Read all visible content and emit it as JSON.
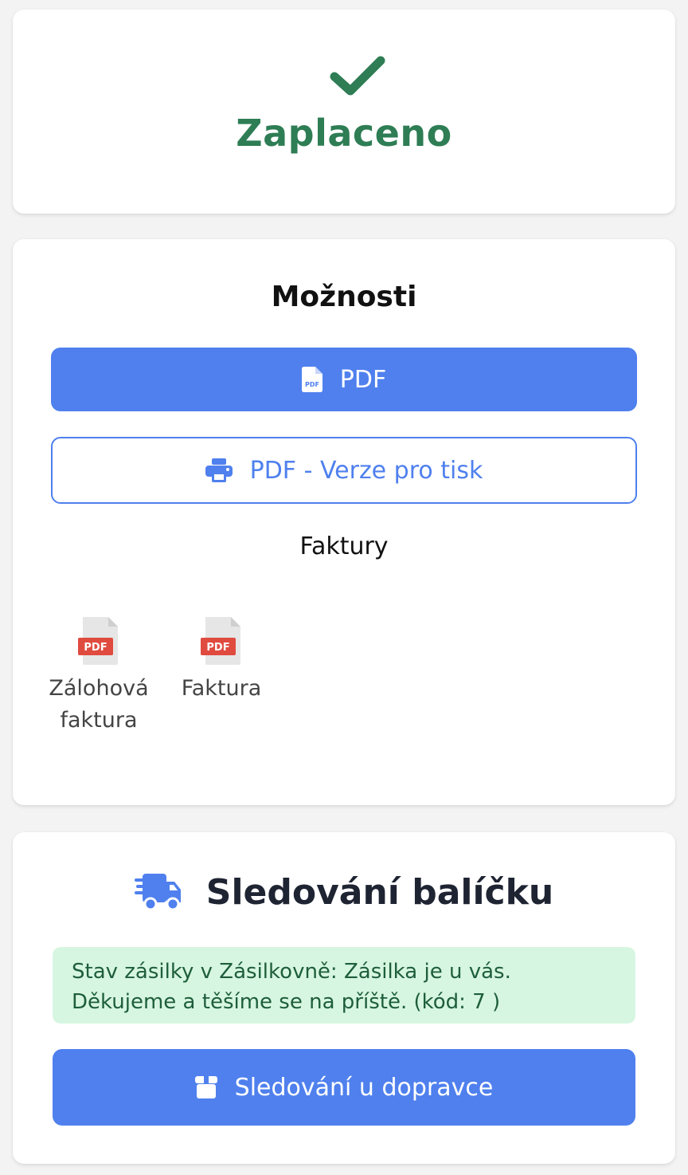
{
  "status": {
    "label": "Zaplaceno",
    "color": "#2e7d55",
    "icon": "check-icon"
  },
  "options": {
    "title": "Možnosti",
    "pdf_button": {
      "label": "PDF",
      "icon": "file-pdf-icon"
    },
    "print_button": {
      "label": "PDF - Verze pro tisk",
      "icon": "printer-icon"
    },
    "invoices_label": "Faktury",
    "files": [
      {
        "label": "Zálohová faktura",
        "icon": "pdf-file-icon"
      },
      {
        "label": "Faktura",
        "icon": "pdf-file-icon"
      }
    ],
    "pdf_badge": "PDF"
  },
  "tracking": {
    "title": "Sledování balíčku",
    "icon": "shipping-truck-icon",
    "status_message": "Stav zásilky v Zásilkovně: Zásilka je u vás. Děkujeme a těšíme se na příště. (kód: 7 )",
    "track_button": {
      "label": "Sledování u dopravce",
      "icon": "box-icon"
    }
  },
  "colors": {
    "accent": "#4f80ee",
    "success_bg": "#d7f6e2",
    "success_text": "#1e5e3b"
  }
}
